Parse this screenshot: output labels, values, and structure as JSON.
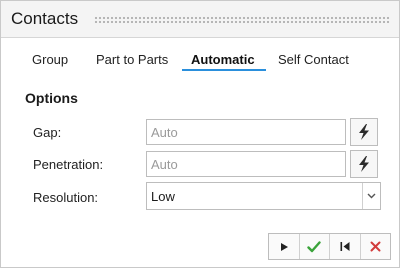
{
  "window": {
    "title": "Contacts"
  },
  "tabs": [
    {
      "label": "Group"
    },
    {
      "label": "Part to Parts"
    },
    {
      "label": "Automatic"
    },
    {
      "label": "Self Contact"
    }
  ],
  "active_tab": "Automatic",
  "options": {
    "heading": "Options",
    "gap": {
      "label": "Gap:",
      "value": "",
      "placeholder": "Auto"
    },
    "penetration": {
      "label": "Penetration:",
      "value": "",
      "placeholder": "Auto"
    },
    "resolution": {
      "label": "Resolution:",
      "value": "Low"
    }
  },
  "icons": {
    "field_action": "lightning-bolt-icon",
    "dropdown": "chevron-down-icon",
    "run": "play-icon",
    "apply": "checkmark-icon",
    "reset": "skip-back-icon",
    "close": "close-icon"
  },
  "colors": {
    "tab_underline": "#2a8fdc",
    "apply_check": "#3aa33a",
    "close_x": "#d23c3c"
  }
}
